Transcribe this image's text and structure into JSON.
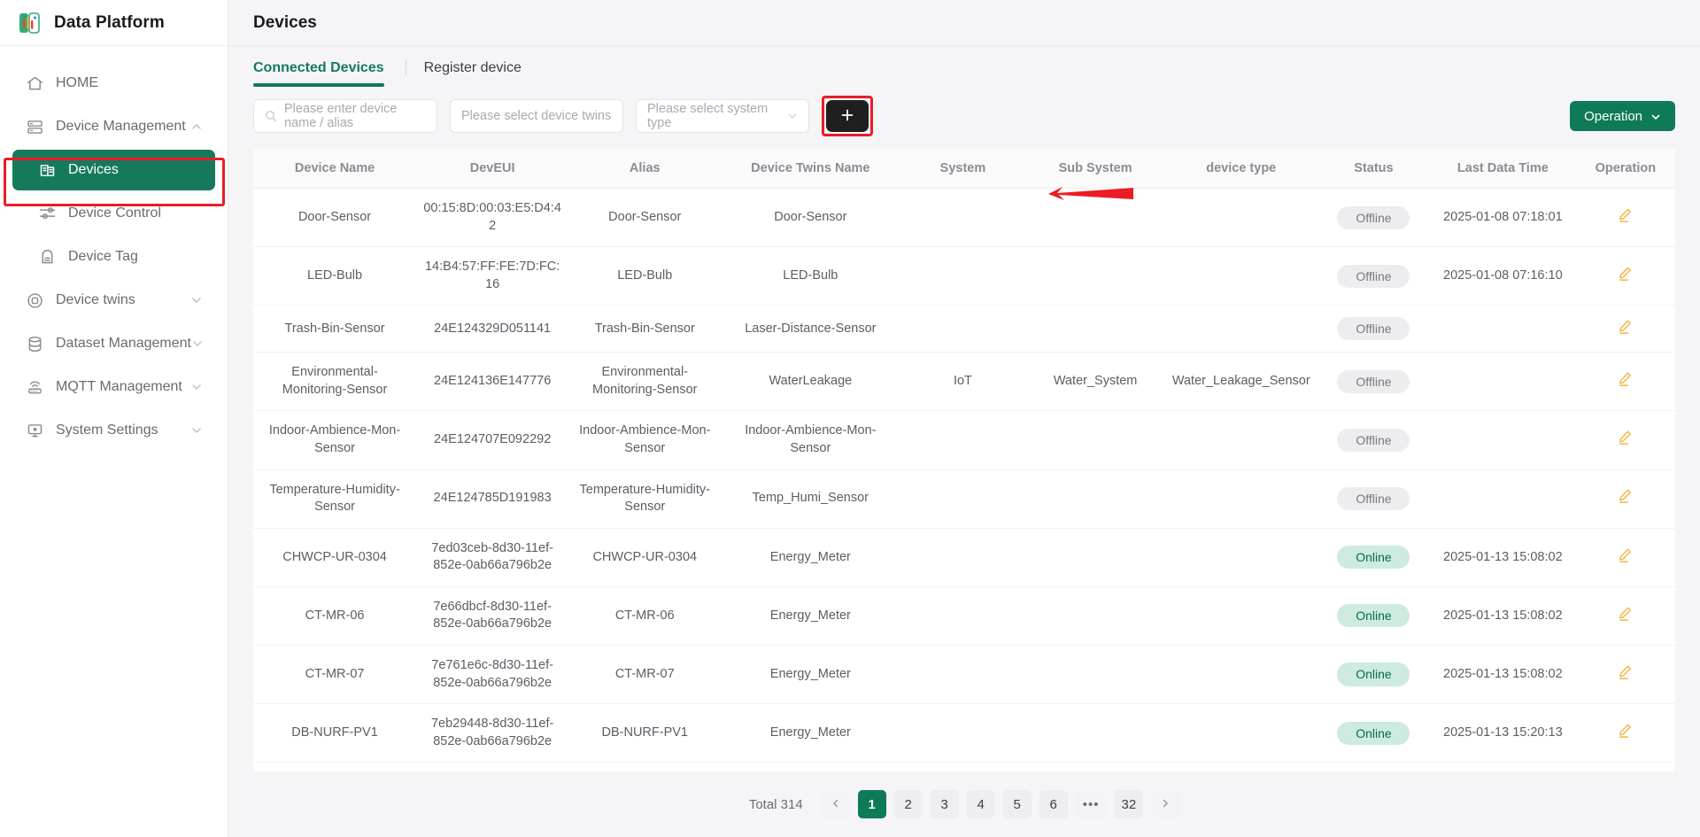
{
  "brand": {
    "title": "Data Platform",
    "logo_icon": "chart-logo-icon"
  },
  "sidebar": {
    "items": [
      {
        "label": "HOME",
        "icon": "home-icon",
        "level": "top",
        "chevron": false,
        "active": false
      },
      {
        "label": "Device Management",
        "icon": "server-icon",
        "level": "top",
        "chevron": "up",
        "active": false
      },
      {
        "label": "Devices",
        "icon": "devices-icon",
        "level": "sub",
        "chevron": false,
        "active": true
      },
      {
        "label": "Device Control",
        "icon": "sliders-icon",
        "level": "sub",
        "chevron": false,
        "active": false
      },
      {
        "label": "Device Tag",
        "icon": "tag-icon",
        "level": "sub",
        "chevron": false,
        "active": false
      },
      {
        "label": "Device twins",
        "icon": "twins-icon",
        "level": "top",
        "chevron": "down",
        "active": false
      },
      {
        "label": "Dataset Management",
        "icon": "database-icon",
        "level": "top",
        "chevron": "down",
        "active": false
      },
      {
        "label": "MQTT Management",
        "icon": "router-icon",
        "level": "top",
        "chevron": "down",
        "active": false
      },
      {
        "label": "System Settings",
        "icon": "monitor-icon",
        "level": "top",
        "chevron": "down",
        "active": false
      }
    ]
  },
  "header": {
    "title": "Devices"
  },
  "tabs": [
    {
      "label": "Connected Devices",
      "active": true
    },
    {
      "label": "Register device",
      "active": false
    }
  ],
  "filters": {
    "search": {
      "placeholder": "Please enter device name / alias",
      "value": "",
      "icon": "search-icon"
    },
    "device_twins": {
      "placeholder": "Please select device twins",
      "value": ""
    },
    "system_type": {
      "placeholder": "Please select system type",
      "value": "",
      "icon": "chevron-down-icon"
    },
    "add_button": {
      "label": "+",
      "icon": "plus-icon"
    }
  },
  "operation_button": {
    "label": "Operation",
    "icon": "chevron-down-icon"
  },
  "table": {
    "columns": [
      "Device Name",
      "DevEUI",
      "Alias",
      "Device Twins Name",
      "System",
      "Sub System",
      "device type",
      "Status",
      "Last Data Time",
      "Operation"
    ],
    "rows": [
      {
        "device_name": "Door-Sensor",
        "deveui": "00:15:8D:00:03:E5:D4:42",
        "alias": "Door-Sensor",
        "twins_name": "Door-Sensor",
        "system": "",
        "sub_system": "",
        "device_type": "",
        "status": "Offline",
        "last_data_time": "2025-01-08 07:18:01",
        "operation": "edit-icon"
      },
      {
        "device_name": "LED-Bulb",
        "deveui": "14:B4:57:FF:FE:7D:FC:16",
        "alias": "LED-Bulb",
        "twins_name": "LED-Bulb",
        "system": "",
        "sub_system": "",
        "device_type": "",
        "status": "Offline",
        "last_data_time": "2025-01-08 07:16:10",
        "operation": "edit-icon"
      },
      {
        "device_name": "Trash-Bin-Sensor",
        "deveui": "24E124329D051141",
        "alias": "Trash-Bin-Sensor",
        "twins_name": "Laser-Distance-Sensor",
        "system": "",
        "sub_system": "",
        "device_type": "",
        "status": "Offline",
        "last_data_time": "",
        "operation": "edit-icon"
      },
      {
        "device_name": "Environmental-Monitoring-Sensor",
        "deveui": "24E124136E147776",
        "alias": "Environmental-Monitoring-Sensor",
        "twins_name": "WaterLeakage",
        "system": "IoT",
        "sub_system": "Water_System",
        "device_type": "Water_Leakage_Sensor",
        "status": "Offline",
        "last_data_time": "",
        "operation": "edit-icon"
      },
      {
        "device_name": "Indoor-Ambience-Mon-Sensor",
        "deveui": "24E124707E092292",
        "alias": "Indoor-Ambience-Mon-Sensor",
        "twins_name": "Indoor-Ambience-Mon-Sensor",
        "system": "",
        "sub_system": "",
        "device_type": "",
        "status": "Offline",
        "last_data_time": "",
        "operation": "edit-icon"
      },
      {
        "device_name": "Temperature-Humidity-Sensor",
        "deveui": "24E124785D191983",
        "alias": "Temperature-Humidity-Sensor",
        "twins_name": "Temp_Humi_Sensor",
        "system": "",
        "sub_system": "",
        "device_type": "",
        "status": "Offline",
        "last_data_time": "",
        "operation": "edit-icon"
      },
      {
        "device_name": "CHWCP-UR-0304",
        "deveui": "7ed03ceb-8d30-11ef-852e-0ab66a796b2e",
        "alias": "CHWCP-UR-0304",
        "twins_name": "Energy_Meter",
        "system": "",
        "sub_system": "",
        "device_type": "",
        "status": "Online",
        "last_data_time": "2025-01-13 15:08:02",
        "operation": "edit-icon"
      },
      {
        "device_name": "CT-MR-06",
        "deveui": "7e66dbcf-8d30-11ef-852e-0ab66a796b2e",
        "alias": "CT-MR-06",
        "twins_name": "Energy_Meter",
        "system": "",
        "sub_system": "",
        "device_type": "",
        "status": "Online",
        "last_data_time": "2025-01-13 15:08:02",
        "operation": "edit-icon"
      },
      {
        "device_name": "CT-MR-07",
        "deveui": "7e761e6c-8d30-11ef-852e-0ab66a796b2e",
        "alias": "CT-MR-07",
        "twins_name": "Energy_Meter",
        "system": "",
        "sub_system": "",
        "device_type": "",
        "status": "Online",
        "last_data_time": "2025-01-13 15:08:02",
        "operation": "edit-icon"
      },
      {
        "device_name": "DB-NURF-PV1",
        "deveui": "7eb29448-8d30-11ef-852e-0ab66a796b2e",
        "alias": "DB-NURF-PV1",
        "twins_name": "Energy_Meter",
        "system": "",
        "sub_system": "",
        "device_type": "",
        "status": "Online",
        "last_data_time": "2025-01-13 15:20:13",
        "operation": "edit-icon"
      }
    ]
  },
  "pagination": {
    "total_label": "Total 314",
    "prev_icon": "chevron-left-icon",
    "next_icon": "chevron-right-icon",
    "pages": [
      "1",
      "2",
      "3",
      "4",
      "5",
      "6",
      "•••",
      "32"
    ],
    "current": "1"
  },
  "colors": {
    "accent_green": "#0e7a57",
    "active_nav": "#157a5b",
    "annotation_red": "#ec1c24",
    "status_online_bg": "#cdebdf",
    "status_offline_bg": "#ededf0",
    "edit_icon": "#f5b544"
  }
}
